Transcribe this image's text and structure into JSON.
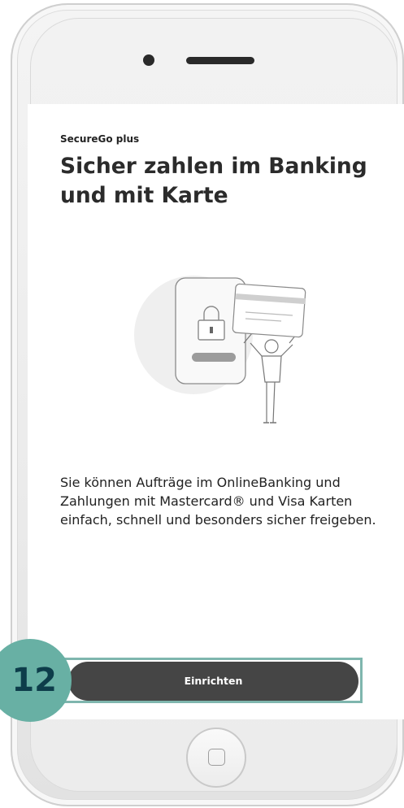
{
  "onboarding": {
    "eyebrow": "SecureGo plus",
    "headline": "Sicher zahlen im Banking und mit Karte",
    "description": "Sie können Aufträge im OnlineBanking und Zahlungen mit Mastercard® und Visa Karten einfach, schnell und besonders sicher freigeben.",
    "primary_button_label": "Einrichten"
  },
  "annotation": {
    "step_number": "12"
  },
  "colors": {
    "button": "#454545",
    "highlight": "#7fb6ae",
    "badge": "#68b0a4",
    "badge_text": "#0d3d4a"
  }
}
